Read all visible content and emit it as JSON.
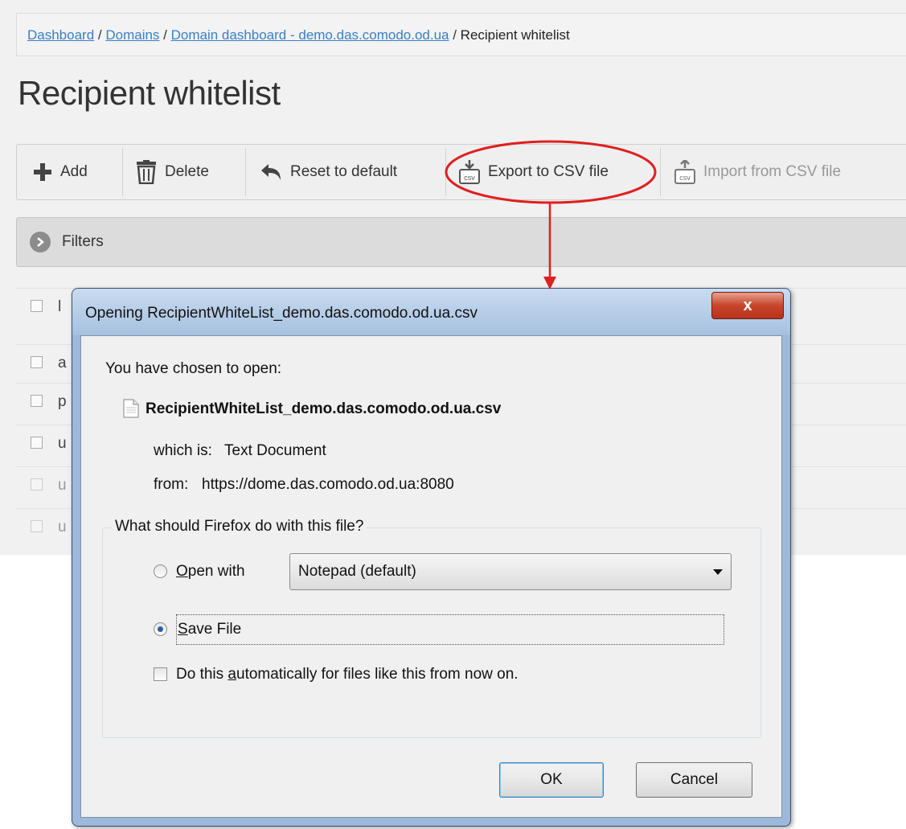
{
  "breadcrumb": {
    "dashboard": "Dashboard",
    "sep1": " / ",
    "domains": "Domains",
    "sep2": " / ",
    "domain_dashboard": "Domain dashboard - demo.das.comodo.od.ua",
    "sep3": " / ",
    "current": "Recipient whitelist"
  },
  "page_title": "Recipient whitelist",
  "toolbar": {
    "add": "Add",
    "delete": "Delete",
    "reset": "Reset to default",
    "export": "Export to CSV file",
    "import": "Import from CSV file"
  },
  "filters_label": "Filters",
  "grid_rows": [
    {
      "text": "l"
    },
    {
      "text": "a"
    },
    {
      "text": "p"
    },
    {
      "text": "u"
    },
    {
      "text": "u"
    },
    {
      "text": "u"
    }
  ],
  "dialog": {
    "title": "Opening RecipientWhiteList_demo.das.comodo.od.ua.csv",
    "close_label": "x",
    "chosen_label": "You have chosen to open:",
    "file_name": "RecipientWhiteList_demo.das.comodo.od.ua.csv",
    "which_is_label": "which is:",
    "which_is_value": "Text Document",
    "from_label": "from:",
    "from_value": "https://dome.das.comodo.od.ua:8080",
    "question": "What should Firefox do with this file?",
    "open_with_mnemonic": "O",
    "open_with_rest": "pen with",
    "open_with_app": "Notepad (default)",
    "save_file_mnemonic": "S",
    "save_file_rest": "ave File",
    "auto_prefix": "Do this ",
    "auto_mnemonic": "a",
    "auto_rest": "utomatically for files like this from now on.",
    "ok": "OK",
    "cancel": "Cancel",
    "selected_action": "Save File",
    "auto_checked": false
  },
  "colors": {
    "link": "#3a7fc4",
    "annotation": "#e01f1f",
    "dialog_frame": "#9db8d8",
    "close_button": "#c7452b"
  }
}
